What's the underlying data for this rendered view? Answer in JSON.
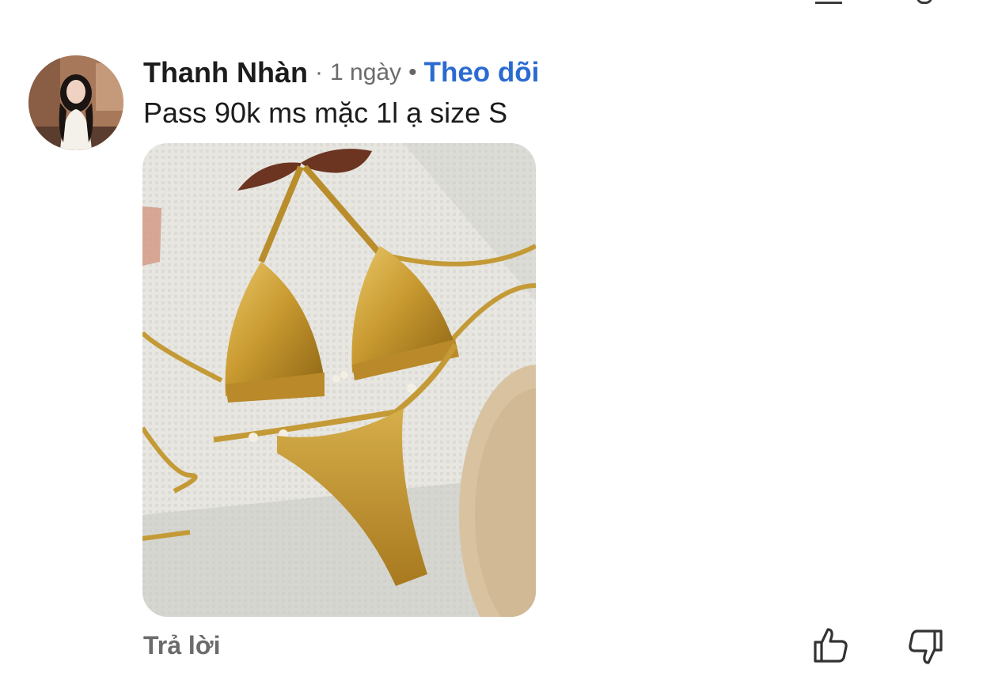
{
  "comment": {
    "author": "Thanh Nhàn",
    "separator_1": "·",
    "time": "1 ngày",
    "separator_2": "•",
    "follow_label": "Theo dõi",
    "text": "Pass 90k ms mặc 1l ạ size S",
    "reply_label": "Trả lời"
  },
  "icons": {
    "like": "thumbs-up-icon",
    "dislike": "thumbs-down-icon"
  },
  "colors": {
    "link": "#2b6bd1",
    "text": "#1c1c1c",
    "muted": "#6b6b6b"
  }
}
